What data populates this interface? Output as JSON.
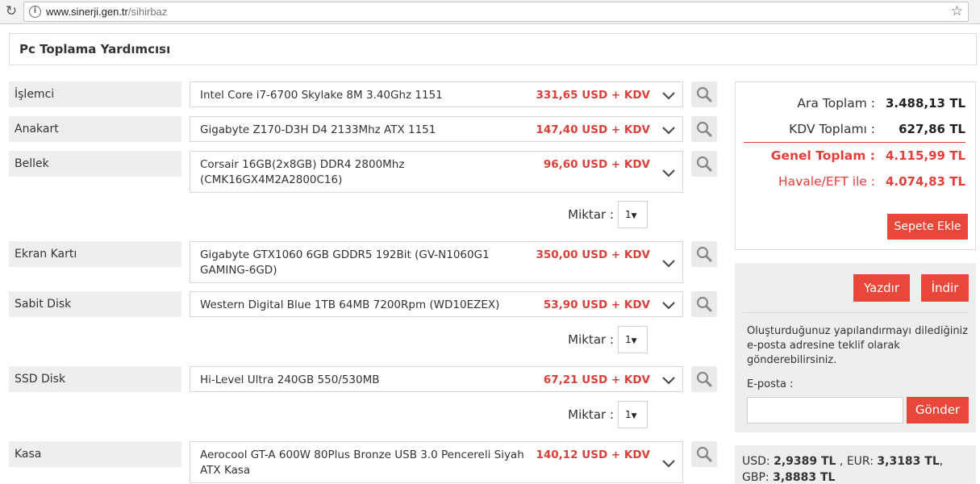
{
  "browser": {
    "url_host": "www.sinerji.gen.tr",
    "url_path": "/sihirbaz"
  },
  "page": {
    "title": "Pc Toplama Yardımcısı"
  },
  "components": [
    {
      "label": "İşlemci",
      "name": "Intel Core i7-6700 Skylake 8M 3.40Ghz 1151",
      "price": "331,65 USD + KDV"
    },
    {
      "label": "Anakart",
      "name": "Gigabyte Z170-D3H D4 2133Mhz ATX 1151",
      "price": "147,40 USD + KDV"
    },
    {
      "label": "Bellek",
      "name": "Corsair 16GB(2x8GB) DDR4 2800Mhz (CMK16GX4M2A2800C16)",
      "price": "96,60 USD + KDV"
    },
    {
      "label": "Ekran Kartı",
      "name": "Gigabyte GTX1060 6GB GDDR5 192Bit (GV-N1060G1 GAMING-6GD)",
      "price": "350,00 USD + KDV"
    },
    {
      "label": "Sabit Disk",
      "name": "Western Digital Blue 1TB 64MB 7200Rpm (WD10EZEX)",
      "price": "53,90 USD + KDV"
    },
    {
      "label": "SSD Disk",
      "name": "Hi-Level Ultra 240GB 550/530MB",
      "price": "67,21 USD + KDV"
    },
    {
      "label": "Kasa",
      "name": "Aerocool GT-A 600W 80Plus Bronze USB 3.0 Pencereli Siyah ATX Kasa",
      "price": "140,12 USD + KDV"
    }
  ],
  "quantity": {
    "label": "Miktar :",
    "bellek_value": "1",
    "sabit_disk_value": "1",
    "ssd_disk_value": "1"
  },
  "summary": {
    "ara_toplam_label": "Ara Toplam :",
    "ara_toplam_value": "3.488,13 TL",
    "kdv_label": "KDV Toplamı :",
    "kdv_value": "627,86 TL",
    "genel_label": "Genel Toplam :",
    "genel_value": "4.115,99 TL",
    "havale_label": "Havale/EFT ile :",
    "havale_value": "4.074,83 TL",
    "add_to_cart": "Sepete Ekle"
  },
  "actions": {
    "print": "Yazdır",
    "download": "İndir",
    "description": "Oluşturduğunuz yapılandırmayı dilediğiniz e-posta adresine teklif olarak gönderebilirsiniz.",
    "email_label": "E-posta :",
    "email_value": "",
    "send": "Gönder"
  },
  "rates": {
    "usd_label": "USD:",
    "usd_value": "2,9389 TL",
    "eur_label": "EUR:",
    "eur_value": "3,3183 TL",
    "gbp_label": "GBP:",
    "gbp_value": "3,8883 TL"
  },
  "colors": {
    "accent": "#e8473a",
    "price": "#d9403a",
    "label_bg": "#eeeeee"
  }
}
